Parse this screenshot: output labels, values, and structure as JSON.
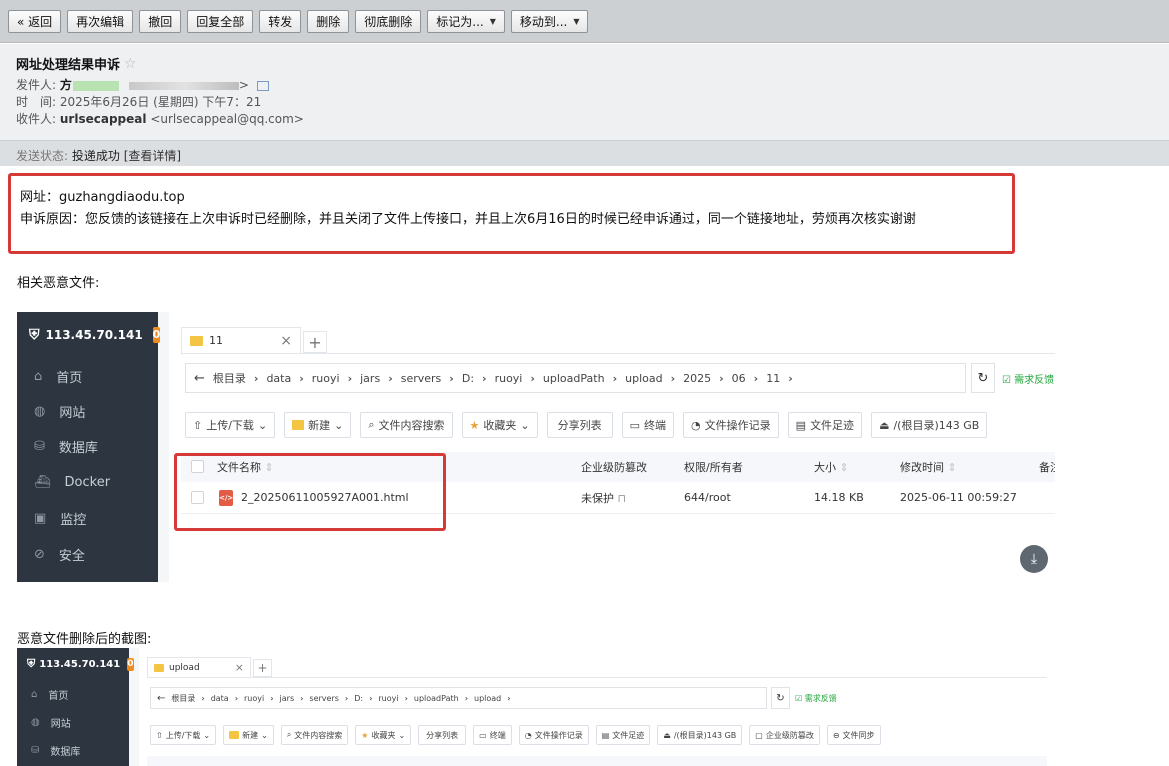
{
  "toolbar": {
    "back": "« 返回",
    "reedit": "再次编辑",
    "recall": "撤回",
    "reply_all": "回复全部",
    "forward": "转发",
    "delete": "删除",
    "perm_delete": "彻底删除",
    "mark_as": "标记为...",
    "move_to": "移动到..."
  },
  "mail": {
    "subject": "网址处理结果申诉",
    "sender_label": "发件人:",
    "sender_name": "方",
    "sender_tail": "> ",
    "time_label": "时　间:",
    "time_value": "2025年6月26日 (星期四) 下午7：21",
    "recipient_label": "收件人:",
    "recipient_name": "urlsecappeal",
    "recipient_addr": "<urlsecappeal@qq.com>",
    "status_label": "发送状态:",
    "status_value": "投递成功",
    "status_link": "[查看详情]"
  },
  "body": {
    "url_line": "网址：guzhangdiaodu.top",
    "reason_line": "申诉原因：您反馈的该链接在上次申诉时已经删除，并且关闭了文件上传接口，并且上次6月16日的时候已经申诉通过，同一个链接地址，劳烦再次核实谢谢",
    "related_files": "相关恶意文件:",
    "after_delete": "恶意文件删除后的截图:"
  },
  "shot1": {
    "server": "113.45.70.141",
    "badge": "0",
    "nav": [
      "首页",
      "网站",
      "数据库",
      "Docker",
      "监控",
      "安全"
    ],
    "tab_name": "11",
    "crumbs": [
      "根目录",
      "data",
      "ruoyi",
      "jars",
      "servers",
      "D:",
      "ruoyi",
      "uploadPath",
      "upload",
      "2025",
      "06",
      "11"
    ],
    "needs": "需求反馈",
    "buttons": [
      "上传/下载",
      "新建",
      "文件内容搜索",
      "收藏夹",
      "分享列表",
      "终端",
      "文件操作记录",
      "文件足迹",
      "/(根目录)143 GB"
    ],
    "headers": {
      "name": "文件名称",
      "protect": "企业级防篡改",
      "perm": "权限/所有者",
      "size": "大小",
      "mtime": "修改时间",
      "note": "备注"
    },
    "row": {
      "name": "2_20250611005927A001.html",
      "protect": "未保护",
      "perm": "644/root",
      "size": "14.18 KB",
      "mtime": "2025-06-11 00:59:27"
    }
  },
  "shot2": {
    "server": "113.45.70.141",
    "badge": "0",
    "nav": [
      "首页",
      "网站",
      "数据库"
    ],
    "tab_name": "upload",
    "crumbs": [
      "根目录",
      "data",
      "ruoyi",
      "jars",
      "servers",
      "D:",
      "ruoyi",
      "uploadPath",
      "upload"
    ],
    "needs": "需求反馈",
    "buttons": [
      "上传/下载",
      "新建",
      "文件内容搜索",
      "收藏夹",
      "分享列表",
      "终端",
      "文件操作记录",
      "文件足迹",
      "/(根目录)143 GB",
      "企业级防篡改",
      "文件同步"
    ]
  }
}
